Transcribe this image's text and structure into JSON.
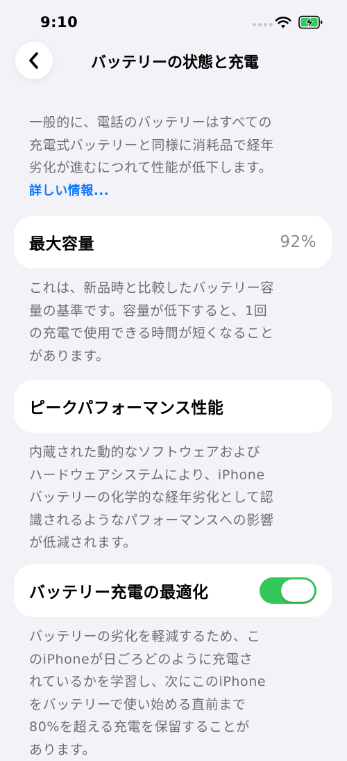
{
  "status_bar": {
    "time": "9:10"
  },
  "nav": {
    "title": "バッテリーの状態と充電"
  },
  "intro": {
    "text": "一般的に、電話のバッテリーはすべての\n充電式バッテリーと同様に消耗品で経年\n劣化が進むにつれて性能が低下します。",
    "link": "詳しい情報..."
  },
  "maximum_capacity": {
    "label": "最大容量",
    "value": "92%",
    "description": "これは、新品時と比較したバッテリー容\n量の基準です。容量が低下すると、1回\nの充電で使用できる時間が短くなること\nがあります。"
  },
  "peak_performance": {
    "label": "ピークパフォーマンス性能",
    "description": "内蔵された動的なソフトウェアおよび\nハードウェアシステムにより、iPhone\nバッテリーの化学的な経年劣化として認\n識されるようなパフォーマンスへの影響\nが低減されます。"
  },
  "optimized_charging": {
    "label": "バッテリー充電の最適化",
    "enabled": true,
    "description": "バッテリーの劣化を軽減するため、こ\nのiPhoneが日ごろどのように充電さ\nれているかを学習し、次にこのiPhone\nをバッテリーで使い始める直前まで\n80%を超える充電を保留することが\nあります。"
  },
  "colors": {
    "background": "#f2f2f7",
    "card": "#ffffff",
    "accent": "#0a7aff",
    "toggle_on": "#34c759",
    "secondary_text": "#6d6d72"
  },
  "icons": {
    "back": "chevron-left-icon",
    "wifi": "wifi-icon",
    "battery": "battery-charging-icon"
  }
}
